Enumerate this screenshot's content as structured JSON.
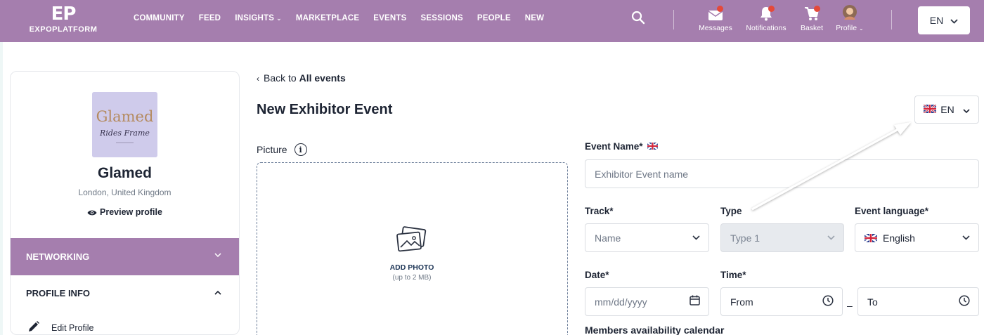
{
  "header": {
    "logo_mark": "EP",
    "logo_text": "EXPOPLATFORM",
    "nav": [
      {
        "label": "COMMUNITY"
      },
      {
        "label": "FEED"
      },
      {
        "label": "INSIGHTS",
        "has_dropdown": true
      },
      {
        "label": "MARKETPLACE"
      },
      {
        "label": "EVENTS"
      },
      {
        "label": "SESSIONS"
      },
      {
        "label": "PEOPLE"
      },
      {
        "label": "NEW"
      }
    ],
    "icons": {
      "messages_label": "Messages",
      "notifications_label": "Notifications",
      "basket_label": "Basket",
      "profile_label": "Profile"
    },
    "language": "EN",
    "bar_color": "#a57eae"
  },
  "sidebar": {
    "company_logo_script": "Glamed",
    "company_logo_sub": "Rides Frame",
    "company_name": "Glamed",
    "location": "London, United Kingdom",
    "preview_label": "Preview profile",
    "networking_label": "NETWORKING",
    "profile_info_label": "PROFILE INFO",
    "edit_profile_label": "Edit Profile"
  },
  "main": {
    "back_prefix": "Back to",
    "back_link": "All events",
    "title": "New Exhibitor Event",
    "language_selector": "EN",
    "picture_label": "Picture",
    "add_photo": "ADD PHOTO",
    "add_photo_hint": "(up to 2 MB)",
    "event_name_label": "Event Name*",
    "event_name_placeholder": "Exhibitor Event name",
    "track_label": "Track*",
    "track_placeholder": "Name",
    "type_label": "Type",
    "type_value": "Type 1",
    "event_language_label": "Event language*",
    "event_language_value": "English",
    "date_label": "Date*",
    "date_placeholder": "mm/dd/yyyy",
    "time_label": "Time*",
    "time_from_placeholder": "From",
    "time_separator": "–",
    "time_to_placeholder": "To",
    "availability_label": "Members availability calendar"
  }
}
